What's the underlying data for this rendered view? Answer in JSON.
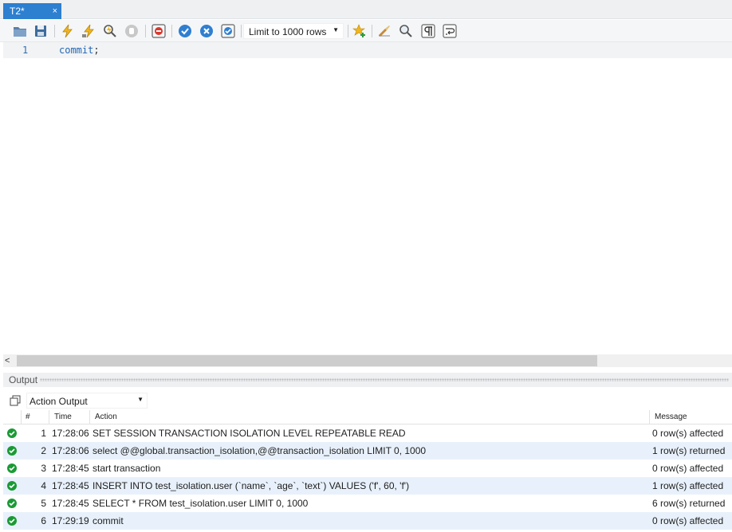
{
  "tab": {
    "title": "T2*",
    "close_glyph": "×"
  },
  "toolbar": {
    "icons": [
      "open-file-icon",
      "save-icon",
      "execute-icon",
      "execute-current-icon",
      "explain-icon",
      "stop-icon",
      "toggle-error-icon",
      "commit-icon",
      "rollback-icon",
      "autocommit-icon",
      "add-snippet-icon",
      "beautify-icon",
      "find-icon",
      "invisible-chars-icon",
      "wrap-lines-icon"
    ],
    "limit_label": "Limit to 1000 rows",
    "caret": "▼"
  },
  "editor": {
    "line_number": "1",
    "code_keyword": "commit",
    "code_punct": ";"
  },
  "scrollbar": {
    "left_arrow": "<"
  },
  "output": {
    "title": "Output",
    "action_select_value": "Action Output",
    "caret": "▼",
    "columns": {
      "num": "#",
      "time": "Time",
      "action": "Action",
      "message": "Message"
    },
    "rows": [
      {
        "num": "1",
        "time": "17:28:06",
        "action": "SET SESSION TRANSACTION ISOLATION LEVEL REPEATABLE READ",
        "message": "0 row(s) affected"
      },
      {
        "num": "2",
        "time": "17:28:06",
        "action": "select @@global.transaction_isolation,@@transaction_isolation LIMIT 0, 1000",
        "message": "1 row(s) returned"
      },
      {
        "num": "3",
        "time": "17:28:45",
        "action": "start transaction",
        "message": "0 row(s) affected"
      },
      {
        "num": "4",
        "time": "17:28:45",
        "action": "INSERT INTO test_isolation.user (`name`, `age`, `text`) VALUES ('f', 60, 'f')",
        "message": "1 row(s) affected"
      },
      {
        "num": "5",
        "time": "17:28:45",
        "action": "SELECT * FROM test_isolation.user LIMIT 0, 1000",
        "message": "6 row(s) returned"
      },
      {
        "num": "6",
        "time": "17:29:19",
        "action": "commit",
        "message": "0 row(s) affected"
      }
    ]
  },
  "colors": {
    "tab_active": "#2d7fd0",
    "success": "#1a9a35",
    "row_alt": "#e8f1fb",
    "keyword": "#2467b2"
  }
}
